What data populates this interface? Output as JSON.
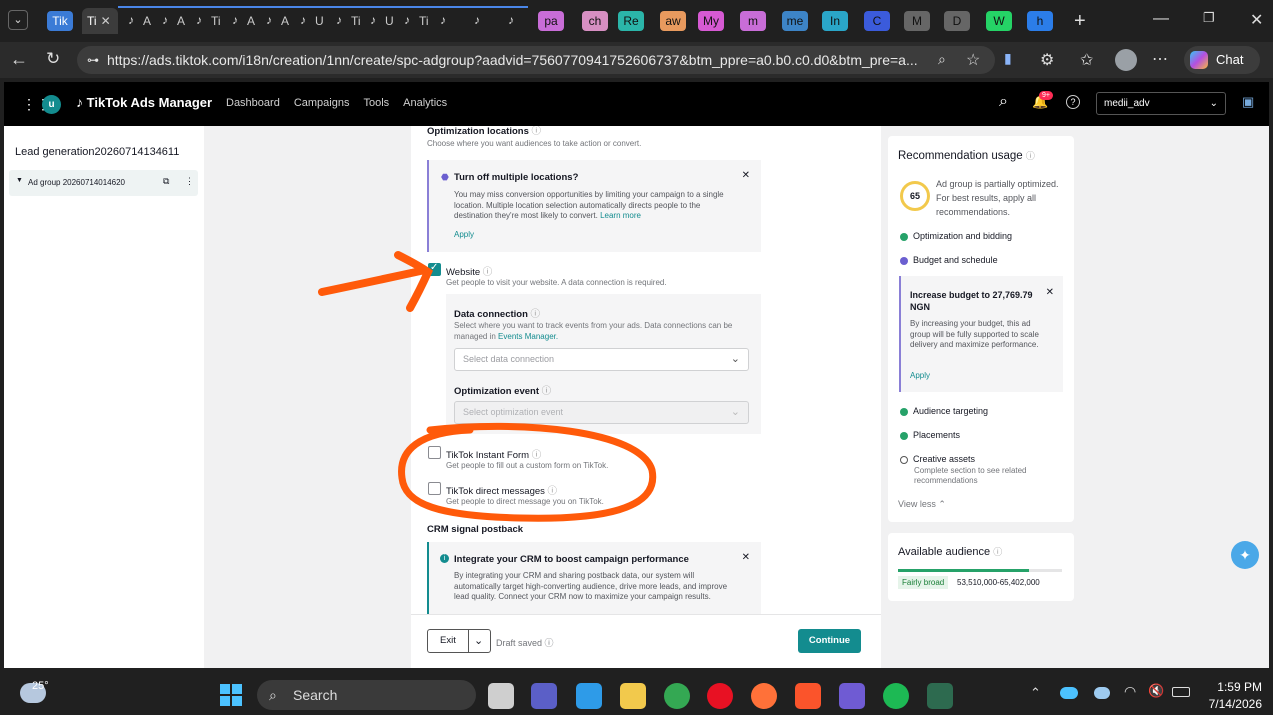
{
  "browser": {
    "tabs": [
      "Tik",
      "Ti",
      "A",
      "A",
      "Ti",
      "A",
      "A",
      "U",
      "Ti",
      "U",
      "Ti"
    ],
    "colored_tabs": [
      {
        "label": "pa",
        "color": "#c86dd7"
      },
      {
        "label": "ch",
        "color": "#d78fc2"
      },
      {
        "label": "Re",
        "color": "#2bb5a9"
      },
      {
        "label": "aw",
        "color": "#e89a5e"
      },
      {
        "label": "My",
        "color": "#d65ad3"
      },
      {
        "label": "m",
        "color": "#c86dd7"
      },
      {
        "label": "me",
        "color": "#3d84c6"
      },
      {
        "label": "In",
        "color": "#2aa6c8"
      },
      {
        "label": "C",
        "color": "#3b5bdb"
      },
      {
        "label": "M",
        "color": "#666"
      },
      {
        "label": "D",
        "color": "#666"
      },
      {
        "label": "W",
        "color": "#25d366"
      },
      {
        "label": "h",
        "color": "#2b7de9"
      }
    ],
    "url": "https://ads.tiktok.com/i18n/creation/1nn/create/spc-adgroup?aadvid=7560770941752606737&btm_ppre=a0.b0.c0.d0&btm_pre=a...",
    "chat_label": "Chat"
  },
  "app": {
    "logo": "TikTok Ads Manager",
    "avatar_letter": "u",
    "nav": [
      "Dashboard",
      "Campaigns",
      "Tools",
      "Analytics"
    ],
    "badge": "9+",
    "account": "medii_adv"
  },
  "left": {
    "campaign": "Lead generation20260714134611",
    "adgroup": "Ad group 20260714014620"
  },
  "main": {
    "opt_title": "Optimization locations",
    "opt_desc": "Choose where you want audiences to take action or convert.",
    "notice_title": "Turn off multiple locations?",
    "notice_body": "You may miss conversion opportunities by limiting your campaign to a single location. Multiple location selection automatically directs people to the destination they're most likely to convert.",
    "learn_more": "Learn more",
    "apply": "Apply",
    "website_label": "Website",
    "website_desc": "Get people to visit your website. A data connection is required.",
    "data_conn_title": "Data connection",
    "data_conn_desc": "Select where you want to track events from your ads. Data connections can be managed in",
    "events_manager": "Events Manager.",
    "data_conn_placeholder": "Select data connection",
    "opt_event_title": "Optimization event",
    "opt_event_placeholder": "Select optimization event",
    "instant_form_label": "TikTok Instant Form",
    "instant_form_desc": "Get people to fill out a custom form on TikTok.",
    "dm_label": "TikTok direct messages",
    "dm_desc": "Get people to direct message you on TikTok.",
    "crm_title": "CRM signal postback",
    "crm_notice_title": "Integrate your CRM to boost campaign performance",
    "crm_notice_body": "By integrating your CRM and sharing postback data, our system will automatically target high-converting audience, drive more leads, and improve lead quality. Connect your CRM now to maximize your campaign results.",
    "exit": "Exit",
    "draft": "Draft saved",
    "continue": "Continue",
    "website_checked": true,
    "instant_form_checked": false,
    "dm_checked": false
  },
  "rec": {
    "title": "Recommendation usage",
    "score": "65",
    "score_text": "Ad group is partially optimized. For best results, apply all recommendations.",
    "items": [
      "Optimization and bidding",
      "Budget and schedule"
    ],
    "budget_title": "Increase budget to 27,769.79 NGN",
    "budget_body": "By increasing your budget, this ad group will be fully supported to scale delivery and maximize performance.",
    "budget_apply": "Apply",
    "items2": [
      "Audience targeting",
      "Placements"
    ],
    "creative": "Creative assets",
    "creative_desc": "Complete section to see related recommendations",
    "view_less": "View less"
  },
  "audience": {
    "title": "Available audience",
    "level": "Fairly broad",
    "range": "53,510,000-65,402,000"
  },
  "taskbar": {
    "temp": "25°",
    "search": "Search",
    "time": "1:59 PM",
    "date": "7/14/2026"
  },
  "colors": {
    "accent": "#138c8f",
    "annotation": "#ff5a0a"
  }
}
